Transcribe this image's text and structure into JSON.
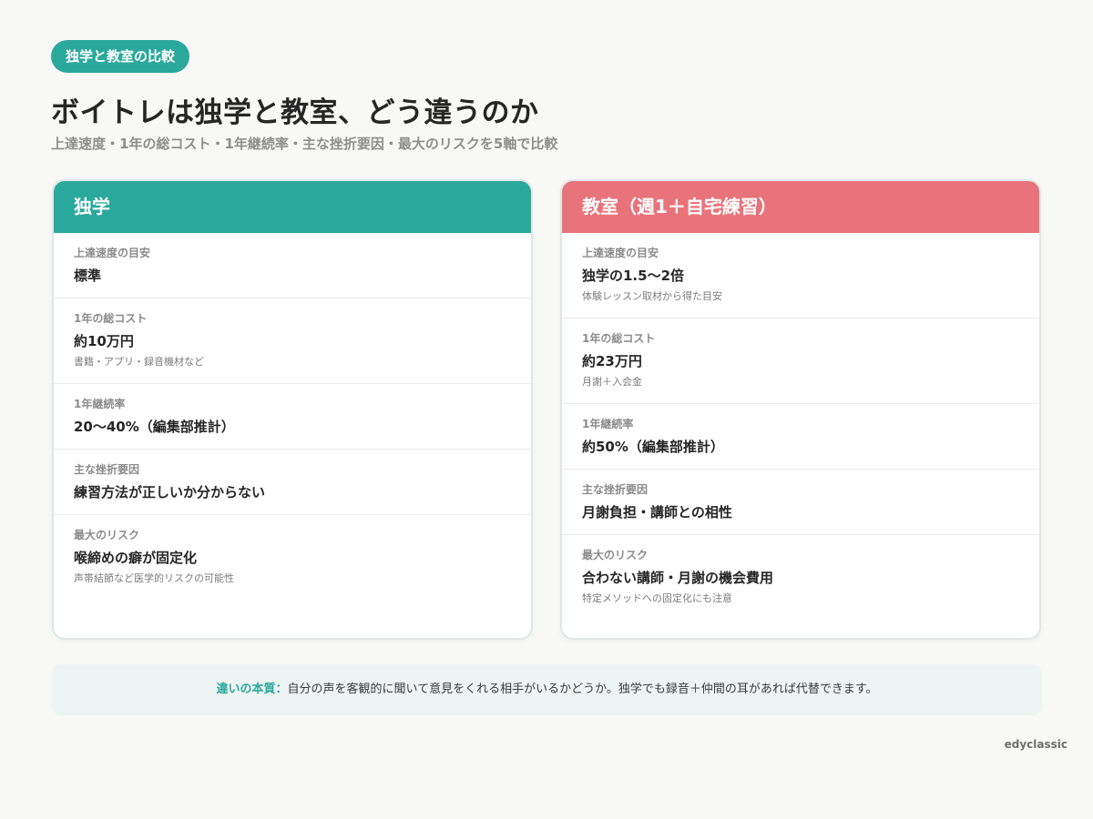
{
  "tag": "独学と教室の比較",
  "title": "ボイトレは独学と教室、どう違うのか",
  "subtitle": "上達速度・1年の総コスト・1年継続率・主な挫折要因・最大のリスクを5軸で比較",
  "cards": {
    "left": {
      "header": "独学",
      "color": "#2aa89c",
      "rows": [
        {
          "label": "上達速度の目安",
          "value": "標準",
          "note": ""
        },
        {
          "label": "1年の総コスト",
          "value": "約10万円",
          "note": "書籍・アプリ・録音機材など"
        },
        {
          "label": "1年継続率",
          "value": "20〜40%（編集部推計）",
          "note": ""
        },
        {
          "label": "主な挫折要因",
          "value": "練習方法が正しいか分からない",
          "note": ""
        },
        {
          "label": "最大のリスク",
          "value": "喉締めの癖が固定化",
          "note": "声帯結節など医学的リスクの可能性"
        }
      ]
    },
    "right": {
      "header": "教室（週1＋自宅練習）",
      "color": "#e9737a",
      "rows": [
        {
          "label": "上達速度の目安",
          "value": "独学の1.5〜2倍",
          "note": "体験レッスン取材から得た目安"
        },
        {
          "label": "1年の総コスト",
          "value": "約23万円",
          "note": "月謝＋入会金"
        },
        {
          "label": "1年継続率",
          "value": "約50%（編集部推計）",
          "note": ""
        },
        {
          "label": "主な挫折要因",
          "value": "月謝負担・講師との相性",
          "note": ""
        },
        {
          "label": "最大のリスク",
          "value": "合わない講師・月謝の機会費用",
          "note": "特定メソッドへの固定化にも注意"
        }
      ]
    }
  },
  "footer": {
    "key": "違いの本質：",
    "text": "自分の声を客観的に聞いて意見をくれる相手がいるかどうか。独学でも録音＋仲間の耳があれば代替できます。"
  },
  "brand": "edyclassic"
}
